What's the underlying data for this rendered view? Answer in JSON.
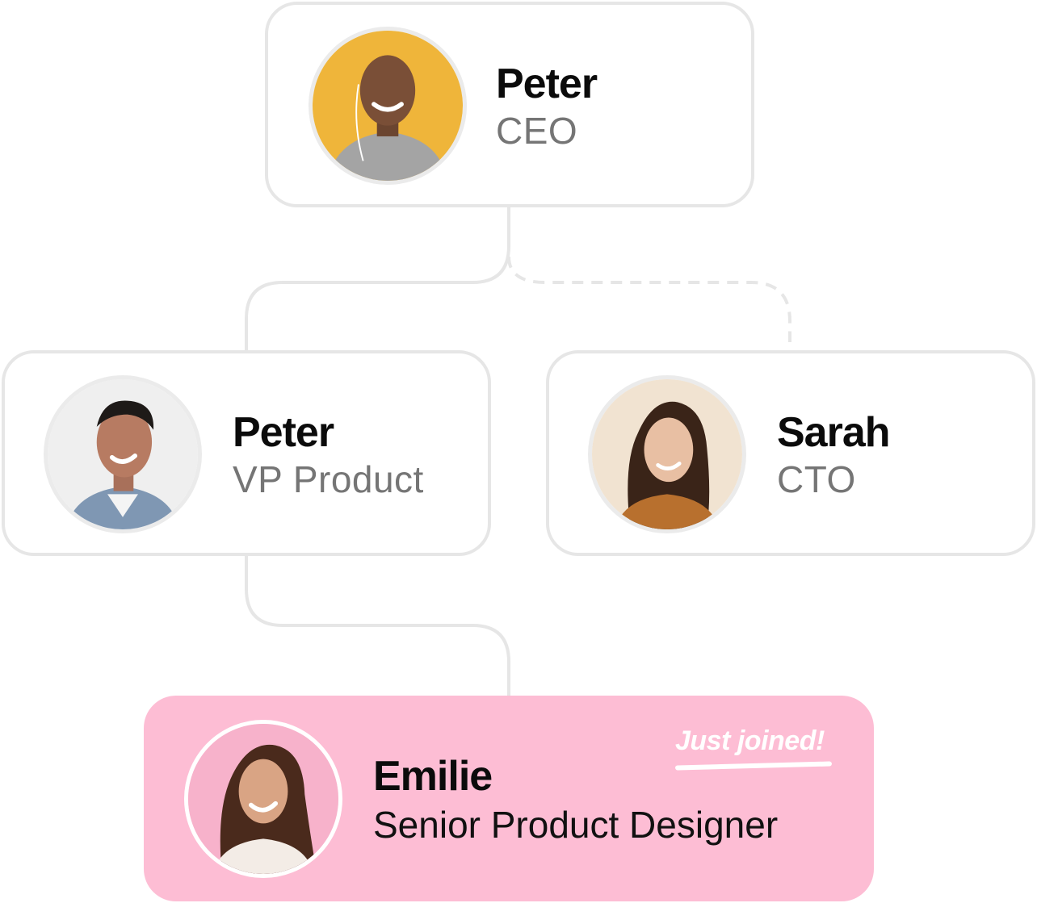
{
  "org_chart": {
    "ceo": {
      "name": "Peter",
      "role": "CEO"
    },
    "vp_product": {
      "name": "Peter",
      "role": "VP Product"
    },
    "cto": {
      "name": "Sarah",
      "role": "CTO"
    },
    "new_hire": {
      "name": "Emilie",
      "role": "Senior Product Designer",
      "badge": "Just joined!"
    }
  },
  "colors": {
    "card_border": "#e6e6e6",
    "connector": "#e6e6e6",
    "highlight_card": "#fdbdd4",
    "name_text": "#0b0b0b",
    "role_text": "#757575"
  }
}
